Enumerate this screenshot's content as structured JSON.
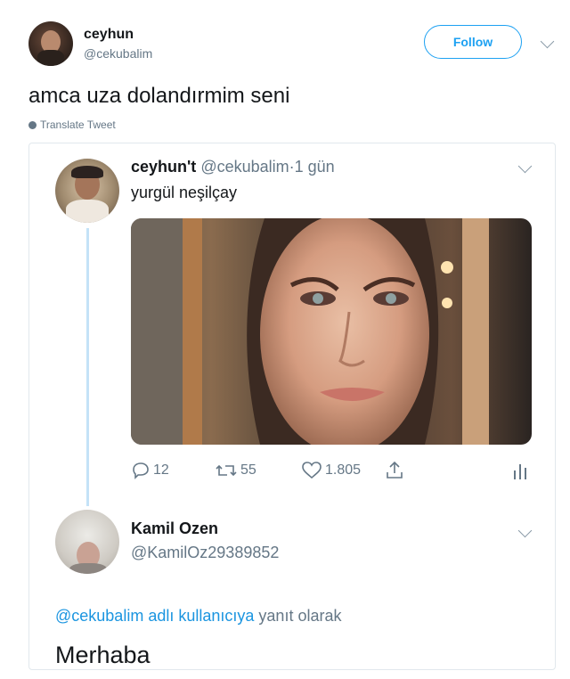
{
  "tweet": {
    "author_name": "ceyhun",
    "author_handle": "@cekubalim",
    "follow_label": "Follow",
    "text": "amca uza dolandırmim seni",
    "translate_label": "Translate Tweet"
  },
  "quoted_tweet": {
    "author_name": "ceyhun't",
    "author_handle": "@cekubalim",
    "separator": "·",
    "time": "1 gün",
    "text": "yurgül neşilçay",
    "replies": "12",
    "retweets": "55",
    "likes": "1.805"
  },
  "reply": {
    "author_name": "Kamil Ozen",
    "author_handle": "@KamilOz29389852",
    "reply_to_mention": "@cekubalim",
    "reply_to_link": "adlı kullanıcıya",
    "reply_to_suffix": "yanıt olarak",
    "text": "Merhaba"
  },
  "colors": {
    "accent": "#1da1f2",
    "link": "#1b95e0",
    "muted": "#657786",
    "border": "#e1e8ed"
  }
}
